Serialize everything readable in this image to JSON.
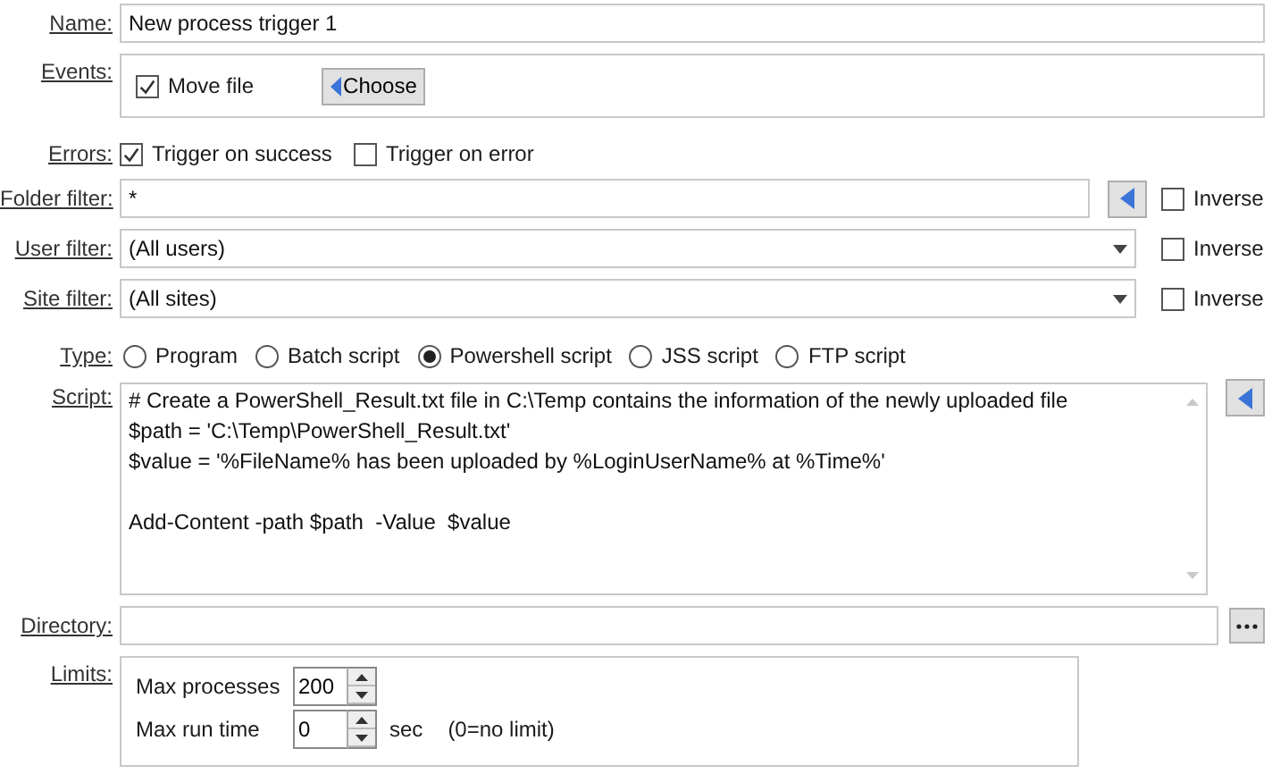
{
  "name": {
    "label": "Name:",
    "value": "New process trigger 1"
  },
  "events": {
    "label": "Events:",
    "items": [
      {
        "label": "Move file",
        "checked": true
      }
    ],
    "choose_button": "Choose"
  },
  "errors": {
    "label": "Errors:",
    "options": [
      {
        "label": "Trigger on success",
        "checked": true
      },
      {
        "label": "Trigger on error",
        "checked": false
      }
    ]
  },
  "filters": [
    {
      "kind": "text",
      "label": "Folder filter:",
      "value": "*",
      "inverse": {
        "label": "Inverse",
        "checked": false
      }
    },
    {
      "kind": "dropdown",
      "label": "User filter:",
      "value": "(All users)",
      "inverse": {
        "label": "Inverse",
        "checked": false
      }
    },
    {
      "kind": "dropdown",
      "label": "Site filter:",
      "value": "(All sites)",
      "inverse": {
        "label": "Inverse",
        "checked": false
      }
    }
  ],
  "type": {
    "label": "Type:",
    "options": [
      {
        "label": "Program",
        "selected": false
      },
      {
        "label": "Batch script",
        "selected": false
      },
      {
        "label": "Powershell script",
        "selected": true
      },
      {
        "label": "JSS script",
        "selected": false
      },
      {
        "label": "FTP script",
        "selected": false
      }
    ]
  },
  "script": {
    "label": "Script:",
    "value": "# Create a PowerShell_Result.txt file in C:\\Temp contains the information of the newly uploaded file\n$path = 'C:\\Temp\\PowerShell_Result.txt'\n$value = '%FileName% has been uploaded by %LoginUserName% at %Time%'\n\nAdd-Content -path $path  -Value  $value"
  },
  "directory": {
    "label": "Directory:"
  },
  "limits": {
    "label": "Limits:",
    "max_processes": {
      "label": "Max processes",
      "value": "200"
    },
    "max_run_time": {
      "label": "Max run time",
      "value": "0",
      "unit": "sec",
      "note": "(0=no limit)"
    }
  }
}
